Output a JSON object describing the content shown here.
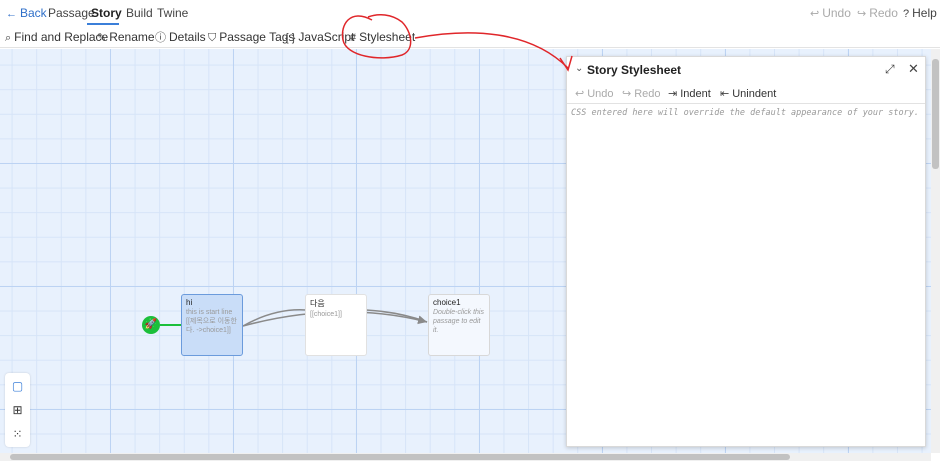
{
  "topbar": {
    "back": "Back",
    "tabs": [
      "Passage",
      "Story",
      "Build",
      "Twine"
    ],
    "undo": "Undo",
    "redo": "Redo",
    "help": "Help"
  },
  "toolbar": {
    "find_replace": "Find and Replace",
    "rename": "Rename",
    "details": "Details",
    "passage_tags": "Passage Tags",
    "javascript": "JavaScript",
    "stylesheet": "Stylesheet"
  },
  "passages": [
    {
      "title": "hi",
      "excerpt": "this is start line [[제목으로 이동한다. ->choice1]]"
    },
    {
      "title": "다음",
      "excerpt": "[[choice1]]"
    },
    {
      "title": "choice1",
      "excerpt": "Double-click this passage to edit it."
    }
  ],
  "panel": {
    "title": "Story Stylesheet",
    "undo": "Undo",
    "redo": "Redo",
    "indent": "Indent",
    "unindent": "Unindent",
    "placeholder": "CSS entered here will override the default appearance of your story."
  },
  "colors": {
    "accent": "#3b7fd9",
    "annotation": "#e0262a",
    "start": "#1bbf3a"
  }
}
